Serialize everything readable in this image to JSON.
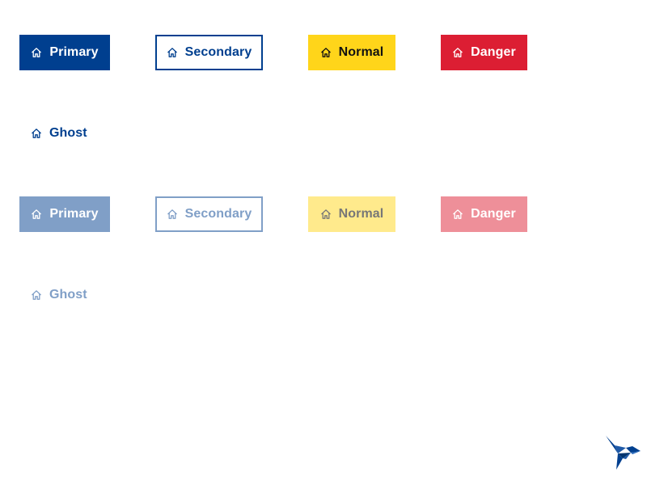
{
  "buttons": {
    "enabled": {
      "primary": {
        "label": "Primary",
        "icon": "home-icon"
      },
      "secondary": {
        "label": "Secondary",
        "icon": "home-icon"
      },
      "normal": {
        "label": "Normal",
        "icon": "home-icon"
      },
      "danger": {
        "label": "Danger",
        "icon": "home-icon"
      },
      "ghost": {
        "label": "Ghost",
        "icon": "home-icon"
      }
    },
    "disabled": {
      "primary": {
        "label": "Primary",
        "icon": "home-icon"
      },
      "secondary": {
        "label": "Secondary",
        "icon": "home-icon"
      },
      "normal": {
        "label": "Normal",
        "icon": "home-icon"
      },
      "danger": {
        "label": "Danger",
        "icon": "home-icon"
      },
      "ghost": {
        "label": "Ghost",
        "icon": "home-icon"
      }
    }
  },
  "colors": {
    "brand_blue": "#003f8f",
    "yellow": "#ffd51a",
    "red": "#dc1e33",
    "white": "#ffffff"
  },
  "logo": {
    "icon": "hummingbird-logo-icon"
  }
}
